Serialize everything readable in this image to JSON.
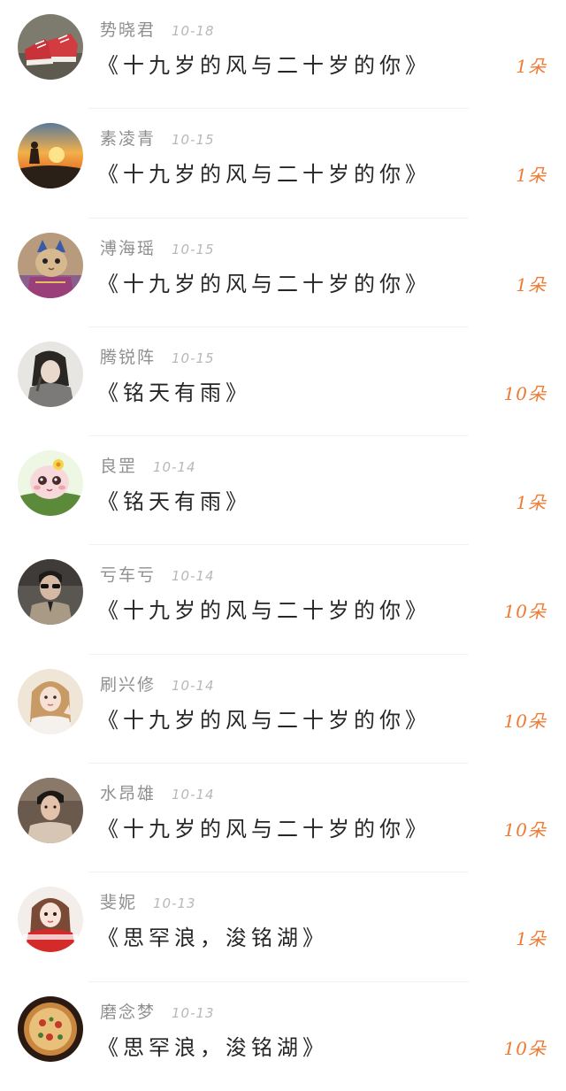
{
  "records": [
    {
      "name": "势晓君",
      "date": "10-18",
      "title": "《十九岁的风与二十岁的你》",
      "amount": "1朵",
      "avatar_icon": "sneakers-avatar-icon"
    },
    {
      "name": "素凌青",
      "date": "10-15",
      "title": "《十九岁的风与二十岁的你》",
      "amount": "1朵",
      "avatar_icon": "sunset-silhouette-avatar-icon"
    },
    {
      "name": "溥海瑶",
      "date": "10-15",
      "title": "《十九岁的风与二十岁的你》",
      "amount": "1朵",
      "avatar_icon": "cat-avatar-icon"
    },
    {
      "name": "腾锐阵",
      "date": "10-15",
      "title": "《铭天有雨》",
      "amount": "10朵",
      "avatar_icon": "girl-photo-avatar-icon"
    },
    {
      "name": "良罡",
      "date": "10-14",
      "title": "《铭天有雨》",
      "amount": "1朵",
      "avatar_icon": "cartoon-creature-avatar-icon"
    },
    {
      "name": "亏车亏",
      "date": "10-14",
      "title": "《十九岁的风与二十岁的你》",
      "amount": "10朵",
      "avatar_icon": "man-sunglasses-avatar-icon"
    },
    {
      "name": "刷兴修",
      "date": "10-14",
      "title": "《十九岁的风与二十岁的你》",
      "amount": "10朵",
      "avatar_icon": "girl-selfie-avatar-icon"
    },
    {
      "name": "水昂雄",
      "date": "10-14",
      "title": "《十九岁的风与二十岁的你》",
      "amount": "10朵",
      "avatar_icon": "young-man-avatar-icon"
    },
    {
      "name": "斐妮",
      "date": "10-13",
      "title": "《思罕浪，浚铭湖》",
      "amount": "1朵",
      "avatar_icon": "girl-red-scarf-avatar-icon"
    },
    {
      "name": "磨念梦",
      "date": "10-13",
      "title": "《思罕浪，浚铭湖》",
      "amount": "10朵",
      "avatar_icon": "pizza-avatar-icon"
    }
  ],
  "colors": {
    "name": "#8f8f8f",
    "date": "#b8b8b8",
    "title": "#262626",
    "amount": "#ef7a32",
    "divider": "#f2f2f2"
  }
}
